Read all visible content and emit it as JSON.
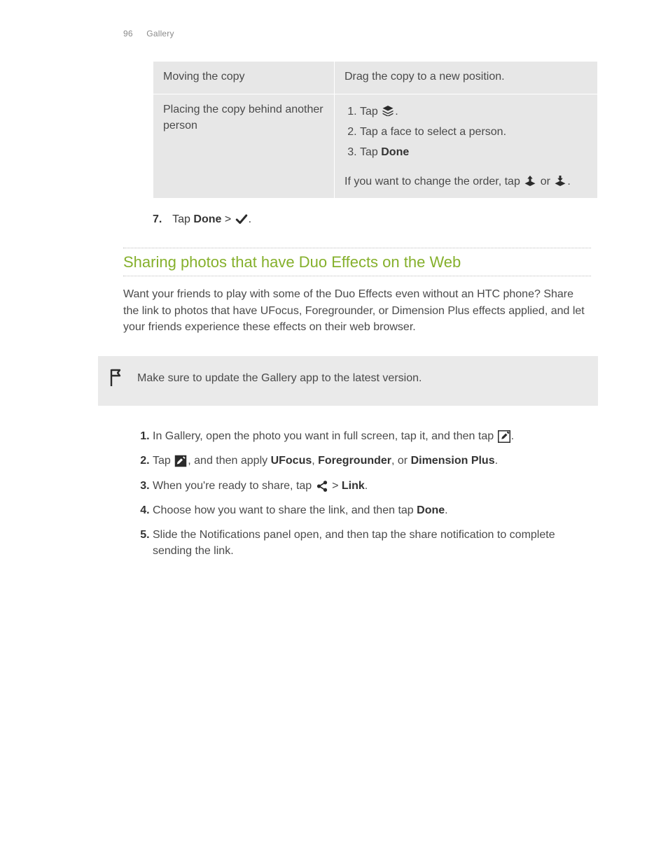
{
  "header": {
    "page_number": "96",
    "section": "Gallery"
  },
  "table": {
    "rows": [
      {
        "label": "Moving the copy",
        "desc_plain": "Drag the copy to a new position."
      },
      {
        "label": "Placing the copy behind another person",
        "sublist": {
          "item1_pre": "Tap ",
          "item1_icon": "layers-icon",
          "item1_post": ".",
          "item2": "Tap a face to select a person.",
          "item3_pre": "Tap ",
          "item3_bold": "Done"
        },
        "after_pre": "If you want to change the order, tap ",
        "after_or": " or ",
        "after_post": "."
      }
    ]
  },
  "step7": {
    "num": "7.",
    "pre": "Tap ",
    "bold": "Done",
    "mid": " > ",
    "post": "."
  },
  "section": {
    "title": "Sharing photos that have Duo Effects on the Web"
  },
  "intro": "Want your friends to play with some of the Duo Effects even without an HTC phone? Share the link to photos that have UFocus, Foregrounder, or Dimension Plus effects applied, and let your friends experience these effects on their web browser.",
  "note": "Make sure to update the Gallery app to the latest version.",
  "steps": {
    "s1": {
      "pre": "In Gallery, open the photo you want in full screen, tap it, and then tap ",
      "post": "."
    },
    "s2": {
      "pre": "Tap ",
      "mid": ", and then apply ",
      "b1": "UFocus",
      "sep1": ", ",
      "b2": "Foregrounder",
      "sep2": ", or ",
      "b3": "Dimension Plus",
      "post": "."
    },
    "s3": {
      "pre": "When you're ready to share, tap ",
      "mid": " > ",
      "bold": "Link",
      "post": "."
    },
    "s4": {
      "pre": "Choose how you want to share the link, and then tap ",
      "bold": "Done",
      "post": "."
    },
    "s5": "Slide the Notifications panel open, and then tap the share notification to complete sending the link."
  }
}
